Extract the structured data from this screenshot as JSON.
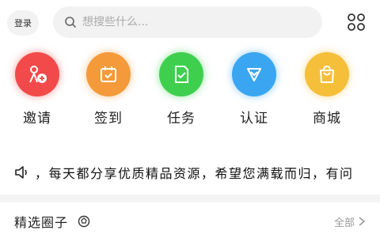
{
  "header": {
    "login_label": "登录",
    "search_placeholder": "想搜些什么...",
    "menu_icon": "grid-icon"
  },
  "entries": [
    {
      "label": "邀请",
      "icon": "invite-icon",
      "color": "#f24a4a"
    },
    {
      "label": "签到",
      "icon": "calendar-icon",
      "color": "#f59a3a"
    },
    {
      "label": "任务",
      "icon": "task-icon",
      "color": "#3fcf4f"
    },
    {
      "label": "认证",
      "icon": "verify-icon",
      "color": "#3aa6f2"
    },
    {
      "label": "商城",
      "icon": "shop-icon",
      "color": "#f5bf3a"
    }
  ],
  "notice": {
    "icon": "speaker-icon",
    "text": "，每天都分享优质精品资源，希望您满载而归，有问"
  },
  "section": {
    "title": "精选圈子",
    "title_icon": "ball-icon",
    "more_label": "全部"
  }
}
